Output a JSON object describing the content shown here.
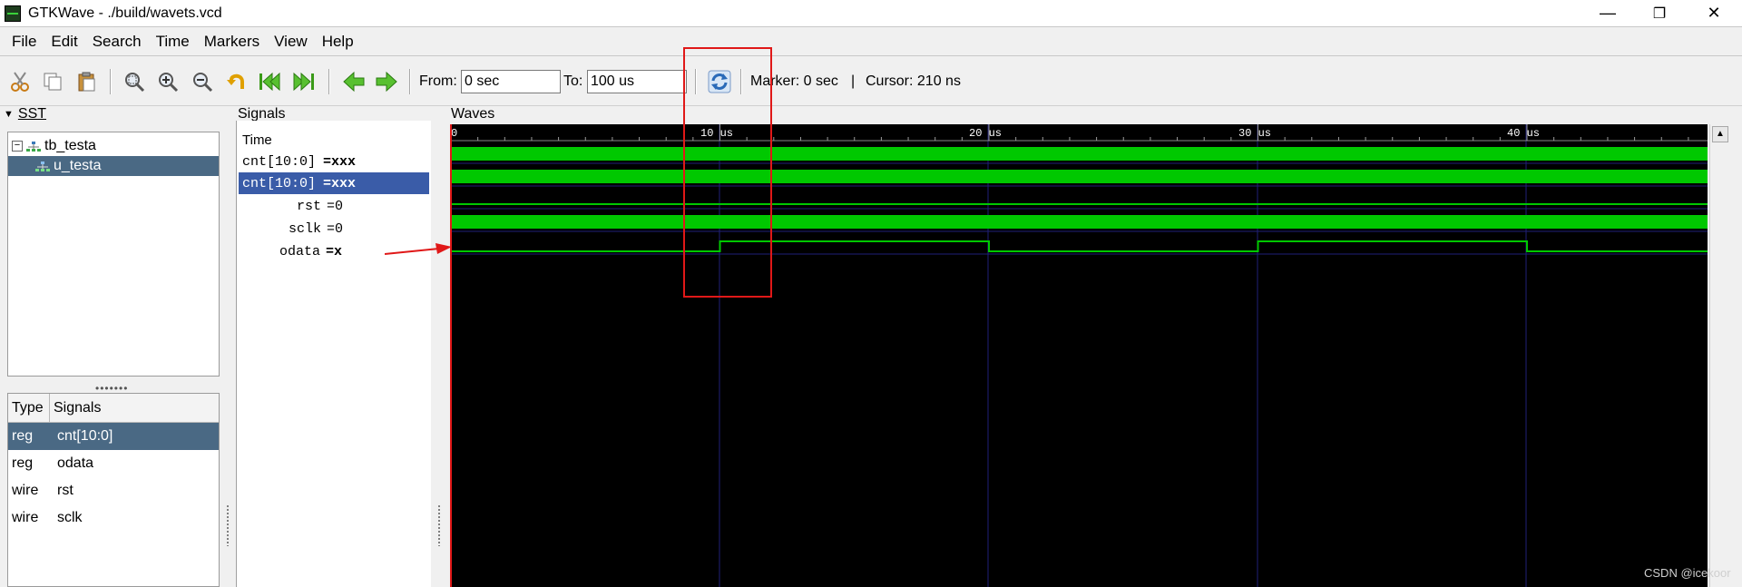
{
  "window": {
    "title": "GTKWave - ./build/wavets.vcd",
    "controls": {
      "minimize": "—",
      "restore": "❐",
      "close": "✕"
    }
  },
  "menu": [
    "File",
    "Edit",
    "Search",
    "Time",
    "Markers",
    "View",
    "Help"
  ],
  "toolbar": {
    "from_label": "From:",
    "from_value": "0 sec",
    "to_label": "To:",
    "to_value": "100 us",
    "marker_text": "Marker: 0 sec",
    "separator": "|",
    "cursor_text": "Cursor: 210 ns",
    "icons": [
      "cut-icon",
      "copy-icon",
      "paste-icon",
      "zoom-fit-icon",
      "zoom-in-icon",
      "zoom-out-icon",
      "undo-zoom-icon",
      "zoom-start-icon",
      "zoom-end-icon",
      "page-back-icon",
      "page-forward-icon",
      "reload-icon"
    ]
  },
  "sst": {
    "label": "SST",
    "tree": [
      {
        "name": "tb_testa",
        "level": 0
      },
      {
        "name": "u_testa",
        "level": 1,
        "selected": true
      }
    ],
    "table": {
      "headers": [
        "Type",
        "Signals"
      ],
      "rows": [
        {
          "type": "reg",
          "signal": "cnt[10:0]",
          "selected": true
        },
        {
          "type": "reg",
          "signal": "odata"
        },
        {
          "type": "wire",
          "signal": "rst"
        },
        {
          "type": "wire",
          "signal": "sclk"
        }
      ]
    }
  },
  "signals_panel": {
    "label": "Signals",
    "header": "Time",
    "rows": [
      {
        "name": "cnt[10:0]",
        "value": "=xxx",
        "selected": false
      },
      {
        "name": "cnt[10:0]",
        "value": "=xxx",
        "selected": true
      },
      {
        "name": "rst",
        "value": "=0"
      },
      {
        "name": "sclk",
        "value": "=0"
      },
      {
        "name": "odata",
        "value": "=x"
      }
    ]
  },
  "waves_panel": {
    "label": "Waves",
    "time_ticks": [
      "0",
      "10 us",
      "20 us",
      "30 us",
      "40 us"
    ],
    "odata_transitions_us": [
      10,
      20,
      30,
      40
    ],
    "colors": {
      "background": "#000000",
      "bus": "#00c800",
      "signal": "#00c800",
      "grid": "#202078",
      "marker": "#e01818"
    }
  },
  "watermark": "CSDN @icekoor"
}
